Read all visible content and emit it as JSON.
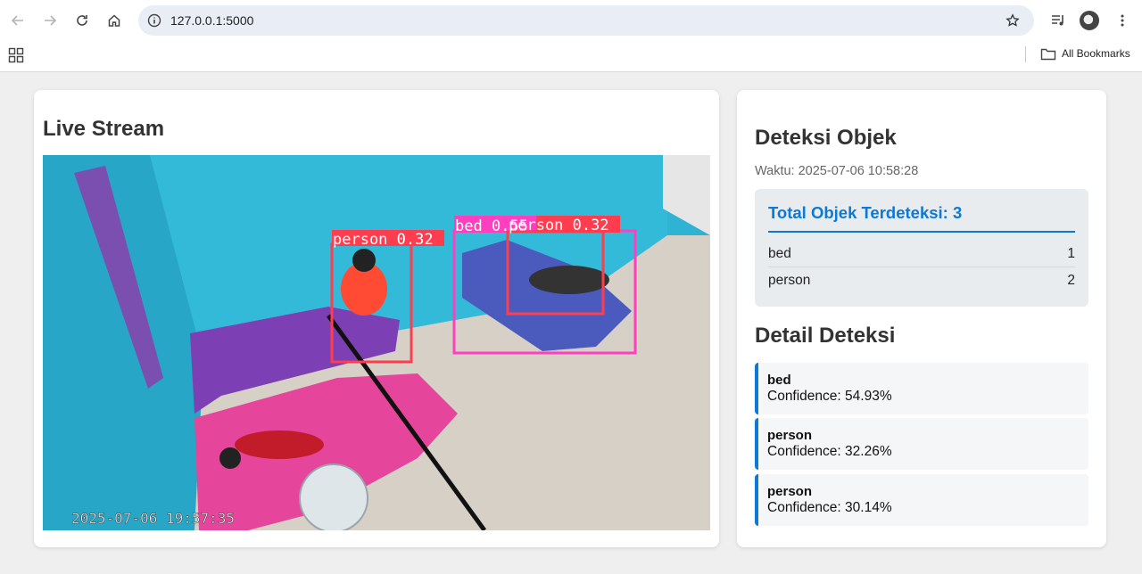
{
  "browser": {
    "url": "127.0.0.1:5000",
    "bookmarks_label": "All Bookmarks"
  },
  "stream": {
    "title": "Live Stream",
    "timestamp": "2025-07-06 19:57:35",
    "boxes": [
      {
        "label": "person 0.32",
        "color": "#ff3d4f"
      },
      {
        "label": "bed 0.55",
        "color": "#ff3fbf"
      },
      {
        "label": "person 0.32",
        "color": "#ff3d4f"
      }
    ]
  },
  "detection": {
    "title": "Deteksi Objek",
    "waktu": "Waktu: 2025-07-06 10:58:28",
    "summary_title": "Total Objek Terdeteksi: 3",
    "counts": [
      {
        "label": "bed",
        "count": "1"
      },
      {
        "label": "person",
        "count": "2"
      }
    ]
  },
  "details": {
    "title": "Detail Deteksi",
    "items": [
      {
        "cls": "bed",
        "conf": "Confidence: 54.93%"
      },
      {
        "cls": "person",
        "conf": "Confidence: 32.26%"
      },
      {
        "cls": "person",
        "conf": "Confidence: 30.14%"
      }
    ]
  },
  "colors": {
    "accent": "#0d78d6",
    "card_bg": "#ffffff",
    "page_bg": "#efefef"
  }
}
